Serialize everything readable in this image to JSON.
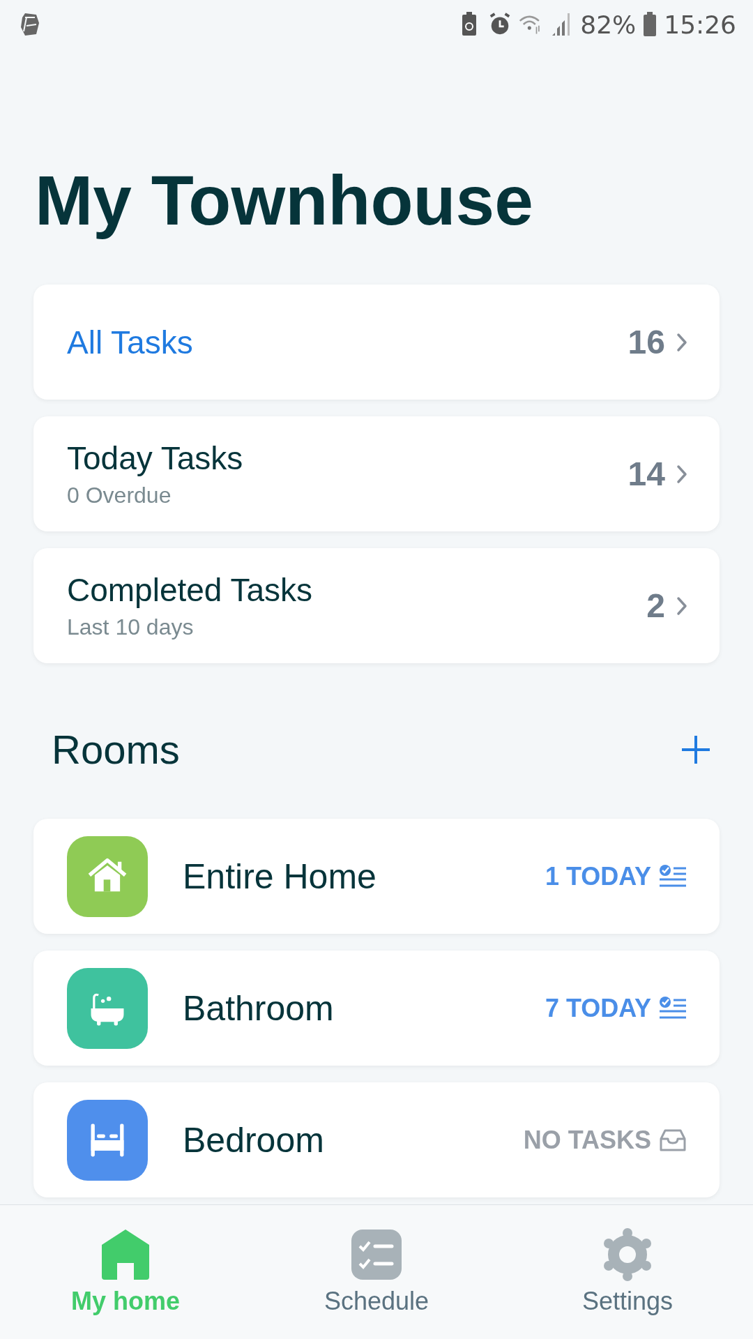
{
  "status_bar": {
    "battery": "82%",
    "time": "15:26"
  },
  "title": "My Townhouse",
  "task_lists": [
    {
      "title": "All Tasks",
      "highlighted": true,
      "count": "16"
    },
    {
      "title": "Today Tasks",
      "highlighted": false,
      "subtitle": "0 Overdue",
      "count": "14"
    },
    {
      "title": "Completed Tasks",
      "highlighted": false,
      "subtitle": "Last 10 days",
      "count": "2"
    }
  ],
  "rooms_header": {
    "title": "Rooms"
  },
  "rooms": [
    {
      "name": "Entire Home",
      "kind": "home",
      "color": "#8fcb55",
      "status": {
        "text": "1 TODAY",
        "kind": "today"
      }
    },
    {
      "name": "Bathroom",
      "kind": "bath",
      "color": "#3fc29e",
      "status": {
        "text": "7 TODAY",
        "kind": "today"
      }
    },
    {
      "name": "Bedroom",
      "kind": "bed",
      "color": "#4f8fec",
      "status": {
        "text": "NO TASKS",
        "kind": "none"
      }
    }
  ],
  "nav": [
    {
      "label": "My home",
      "kind": "home",
      "selected": true
    },
    {
      "label": "Schedule",
      "kind": "schedule",
      "selected": false
    },
    {
      "label": "Settings",
      "kind": "settings",
      "selected": false
    }
  ]
}
